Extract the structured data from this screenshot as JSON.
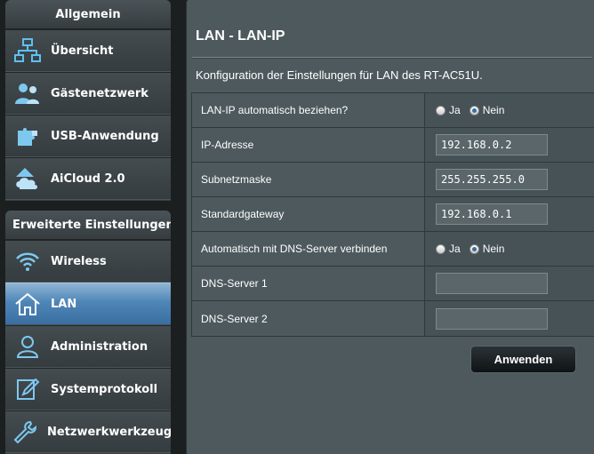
{
  "sidebar": {
    "general_header": "Allgemein",
    "general_items": [
      {
        "label": "Übersicht",
        "icon": "network-map-icon"
      },
      {
        "label": "Gästenetzwerk",
        "icon": "guest-network-icon"
      },
      {
        "label": "USB-Anwendung",
        "icon": "puzzle-icon"
      },
      {
        "label": "AiCloud 2.0",
        "icon": "cloud-icon"
      }
    ],
    "advanced_header": "Erweiterte Einstellungen",
    "advanced_items": [
      {
        "label": "Wireless",
        "icon": "wifi-icon"
      },
      {
        "label": "LAN",
        "icon": "home-icon",
        "active": true
      },
      {
        "label": "Administration",
        "icon": "user-icon"
      },
      {
        "label": "Systemprotokoll",
        "icon": "edit-icon"
      },
      {
        "label": "Netzwerkwerkzeuge",
        "icon": "wrench-icon"
      }
    ]
  },
  "main": {
    "title": "LAN - LAN-IP",
    "description": "Konfiguration der Einstellungen für LAN des RT-AC51U.",
    "rows": [
      {
        "label": "LAN-IP automatisch beziehen?",
        "type": "radio",
        "yes": "Ja",
        "no": "Nein",
        "selected": "no"
      },
      {
        "label": "IP-Adresse",
        "type": "input",
        "value": "192.168.0.2"
      },
      {
        "label": "Subnetzmaske",
        "type": "input",
        "value": "255.255.255.0"
      },
      {
        "label": "Standardgateway",
        "type": "input",
        "value": "192.168.0.1"
      },
      {
        "label": "Automatisch mit DNS-Server verbinden",
        "type": "radio",
        "yes": "Ja",
        "no": "Nein",
        "selected": "no"
      },
      {
        "label": "DNS-Server 1",
        "type": "input",
        "value": ""
      },
      {
        "label": "DNS-Server 2",
        "type": "input",
        "value": ""
      }
    ],
    "apply_label": "Anwenden"
  },
  "colors": {
    "active_item": "#4f86b8",
    "panel_bg": "#4d595d",
    "sidebar_bg": "#3a4246"
  }
}
